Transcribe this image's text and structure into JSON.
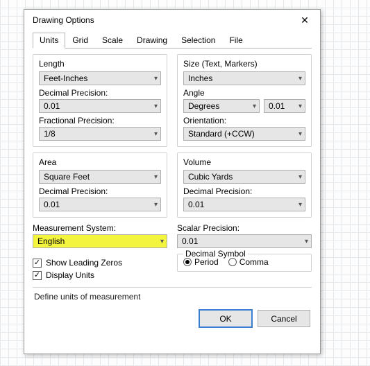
{
  "window": {
    "title": "Drawing Options"
  },
  "tabs": [
    "Units",
    "Grid",
    "Scale",
    "Drawing",
    "Selection",
    "File"
  ],
  "active_tab_index": 0,
  "left": {
    "length": {
      "title": "Length",
      "value": "Feet-Inches",
      "decimal_precision_label": "Decimal Precision:",
      "decimal_precision_value": "0.01",
      "fractional_precision_label": "Fractional Precision:",
      "fractional_precision_value": "1/8"
    },
    "area": {
      "title": "Area",
      "value": "Square Feet",
      "decimal_precision_label": "Decimal Precision:",
      "decimal_precision_value": "0.01"
    },
    "measurement_system": {
      "label": "Measurement System:",
      "value": "English"
    },
    "show_leading_zeros_label": "Show Leading Zeros",
    "display_units_label": "Display Units"
  },
  "right": {
    "size": {
      "title": "Size (Text, Markers)",
      "value": "Inches",
      "angle_label": "Angle",
      "angle_unit_value": "Degrees",
      "angle_precision_value": "0.01",
      "orientation_label": "Orientation:",
      "orientation_value": "Standard (+CCW)"
    },
    "volume": {
      "title": "Volume",
      "value": "Cubic Yards",
      "decimal_precision_label": "Decimal Precision:",
      "decimal_precision_value": "0.01"
    },
    "scalar": {
      "label": "Scalar Precision:",
      "value": "0.01"
    },
    "decimal_symbol": {
      "legend": "Decimal Symbol",
      "period_label": "Period",
      "comma_label": "Comma",
      "selected": "period"
    }
  },
  "hint": "Define units of measurement",
  "buttons": {
    "ok": "OK",
    "cancel": "Cancel"
  }
}
